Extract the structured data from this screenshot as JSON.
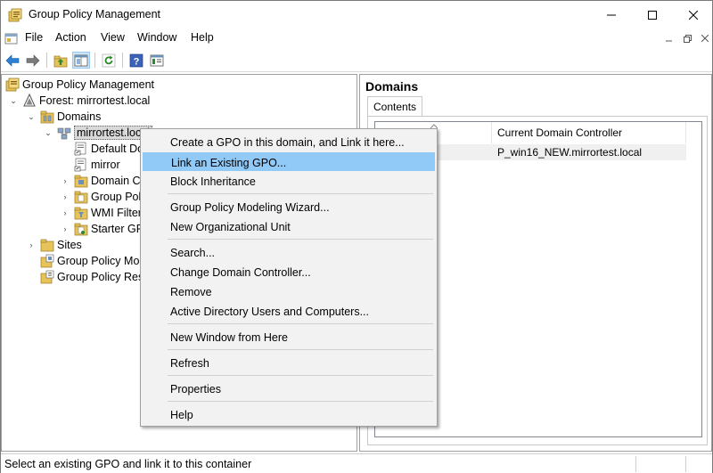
{
  "window": {
    "title": "Group Policy Management"
  },
  "menu": {
    "file": "File",
    "action": "Action",
    "view": "View",
    "window": "Window",
    "help": "Help"
  },
  "tree": {
    "root": "Group Policy Management",
    "forest": "Forest: mirrortest.local",
    "domains": "Domains",
    "domain": "mirrortest.local",
    "default_policy": "Default Do",
    "mirror": "mirror",
    "domain_controllers": "Domain C",
    "group_policy_objects": "Group Pol",
    "wmi_filters": "WMI Filter",
    "starter_gpos": "Starter GP",
    "sites": "Sites",
    "modeling": "Group Policy Mo",
    "results": "Group Policy Res"
  },
  "right_pane": {
    "title": "Domains",
    "tab": "Contents",
    "column_controller": "Current Domain Controller",
    "row_controller": "P_win16_NEW.mirrortest.local"
  },
  "context_menu": {
    "items": [
      "Create a GPO in this domain, and Link it here...",
      "Link an Existing GPO...",
      "Block Inheritance",
      "Group Policy Modeling Wizard...",
      "New Organizational Unit",
      "Search...",
      "Change Domain Controller...",
      "Remove",
      "Active Directory Users and Computers...",
      "New Window from Here",
      "Refresh",
      "Properties",
      "Help"
    ]
  },
  "statusbar": {
    "text": "Select an existing GPO and link it to this container"
  },
  "icons": {
    "app": "gpmc-icon",
    "back": "back-arrow-icon",
    "forward": "forward-arrow-icon",
    "up": "up-folder-icon",
    "show_hide": "show-hide-tree-icon",
    "refresh": "refresh-icon",
    "help": "help-icon",
    "properties": "properties-icon"
  },
  "colors": {
    "highlight": "#91c9f7",
    "accent": "#0078d7"
  }
}
